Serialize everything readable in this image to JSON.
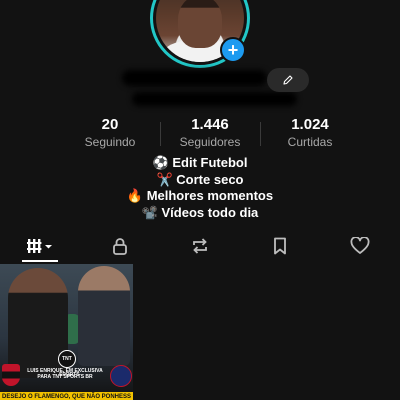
{
  "profile": {
    "avatar_add_symbol": "+",
    "edit_icon": "pencil-icon"
  },
  "stats": [
    {
      "value": "20",
      "label": "Seguindo"
    },
    {
      "value": "1.446",
      "label": "Seguidores"
    },
    {
      "value": "1.024",
      "label": "Curtidas"
    }
  ],
  "bio": [
    "⚽ Edit Futebol",
    "✂️ Corte seco",
    "🔥 Melhores momentos",
    "📽️ Vídeos todo dia"
  ],
  "tabs": [
    {
      "icon": "grid-icon",
      "active": true
    },
    {
      "icon": "lock-icon",
      "active": false
    },
    {
      "icon": "repost-icon",
      "active": false
    },
    {
      "icon": "bookmark-icon",
      "active": false
    },
    {
      "icon": "heart-icon",
      "active": false
    }
  ],
  "grid": {
    "thumb1": {
      "tnt_badge": "TNT SPORTS",
      "caption": "LUIS ENRIQUE, EM EXCLUSIVA PARA TNT SPORTS BR",
      "banner": "DESEJO O FLAMENGO, QUE NÃO PONHESS"
    }
  },
  "colors": {
    "background": "#121212",
    "avatar_ring": "#22c7c7",
    "add_button": "#1d9bf0",
    "secondary_text": "#a8a8a8"
  }
}
